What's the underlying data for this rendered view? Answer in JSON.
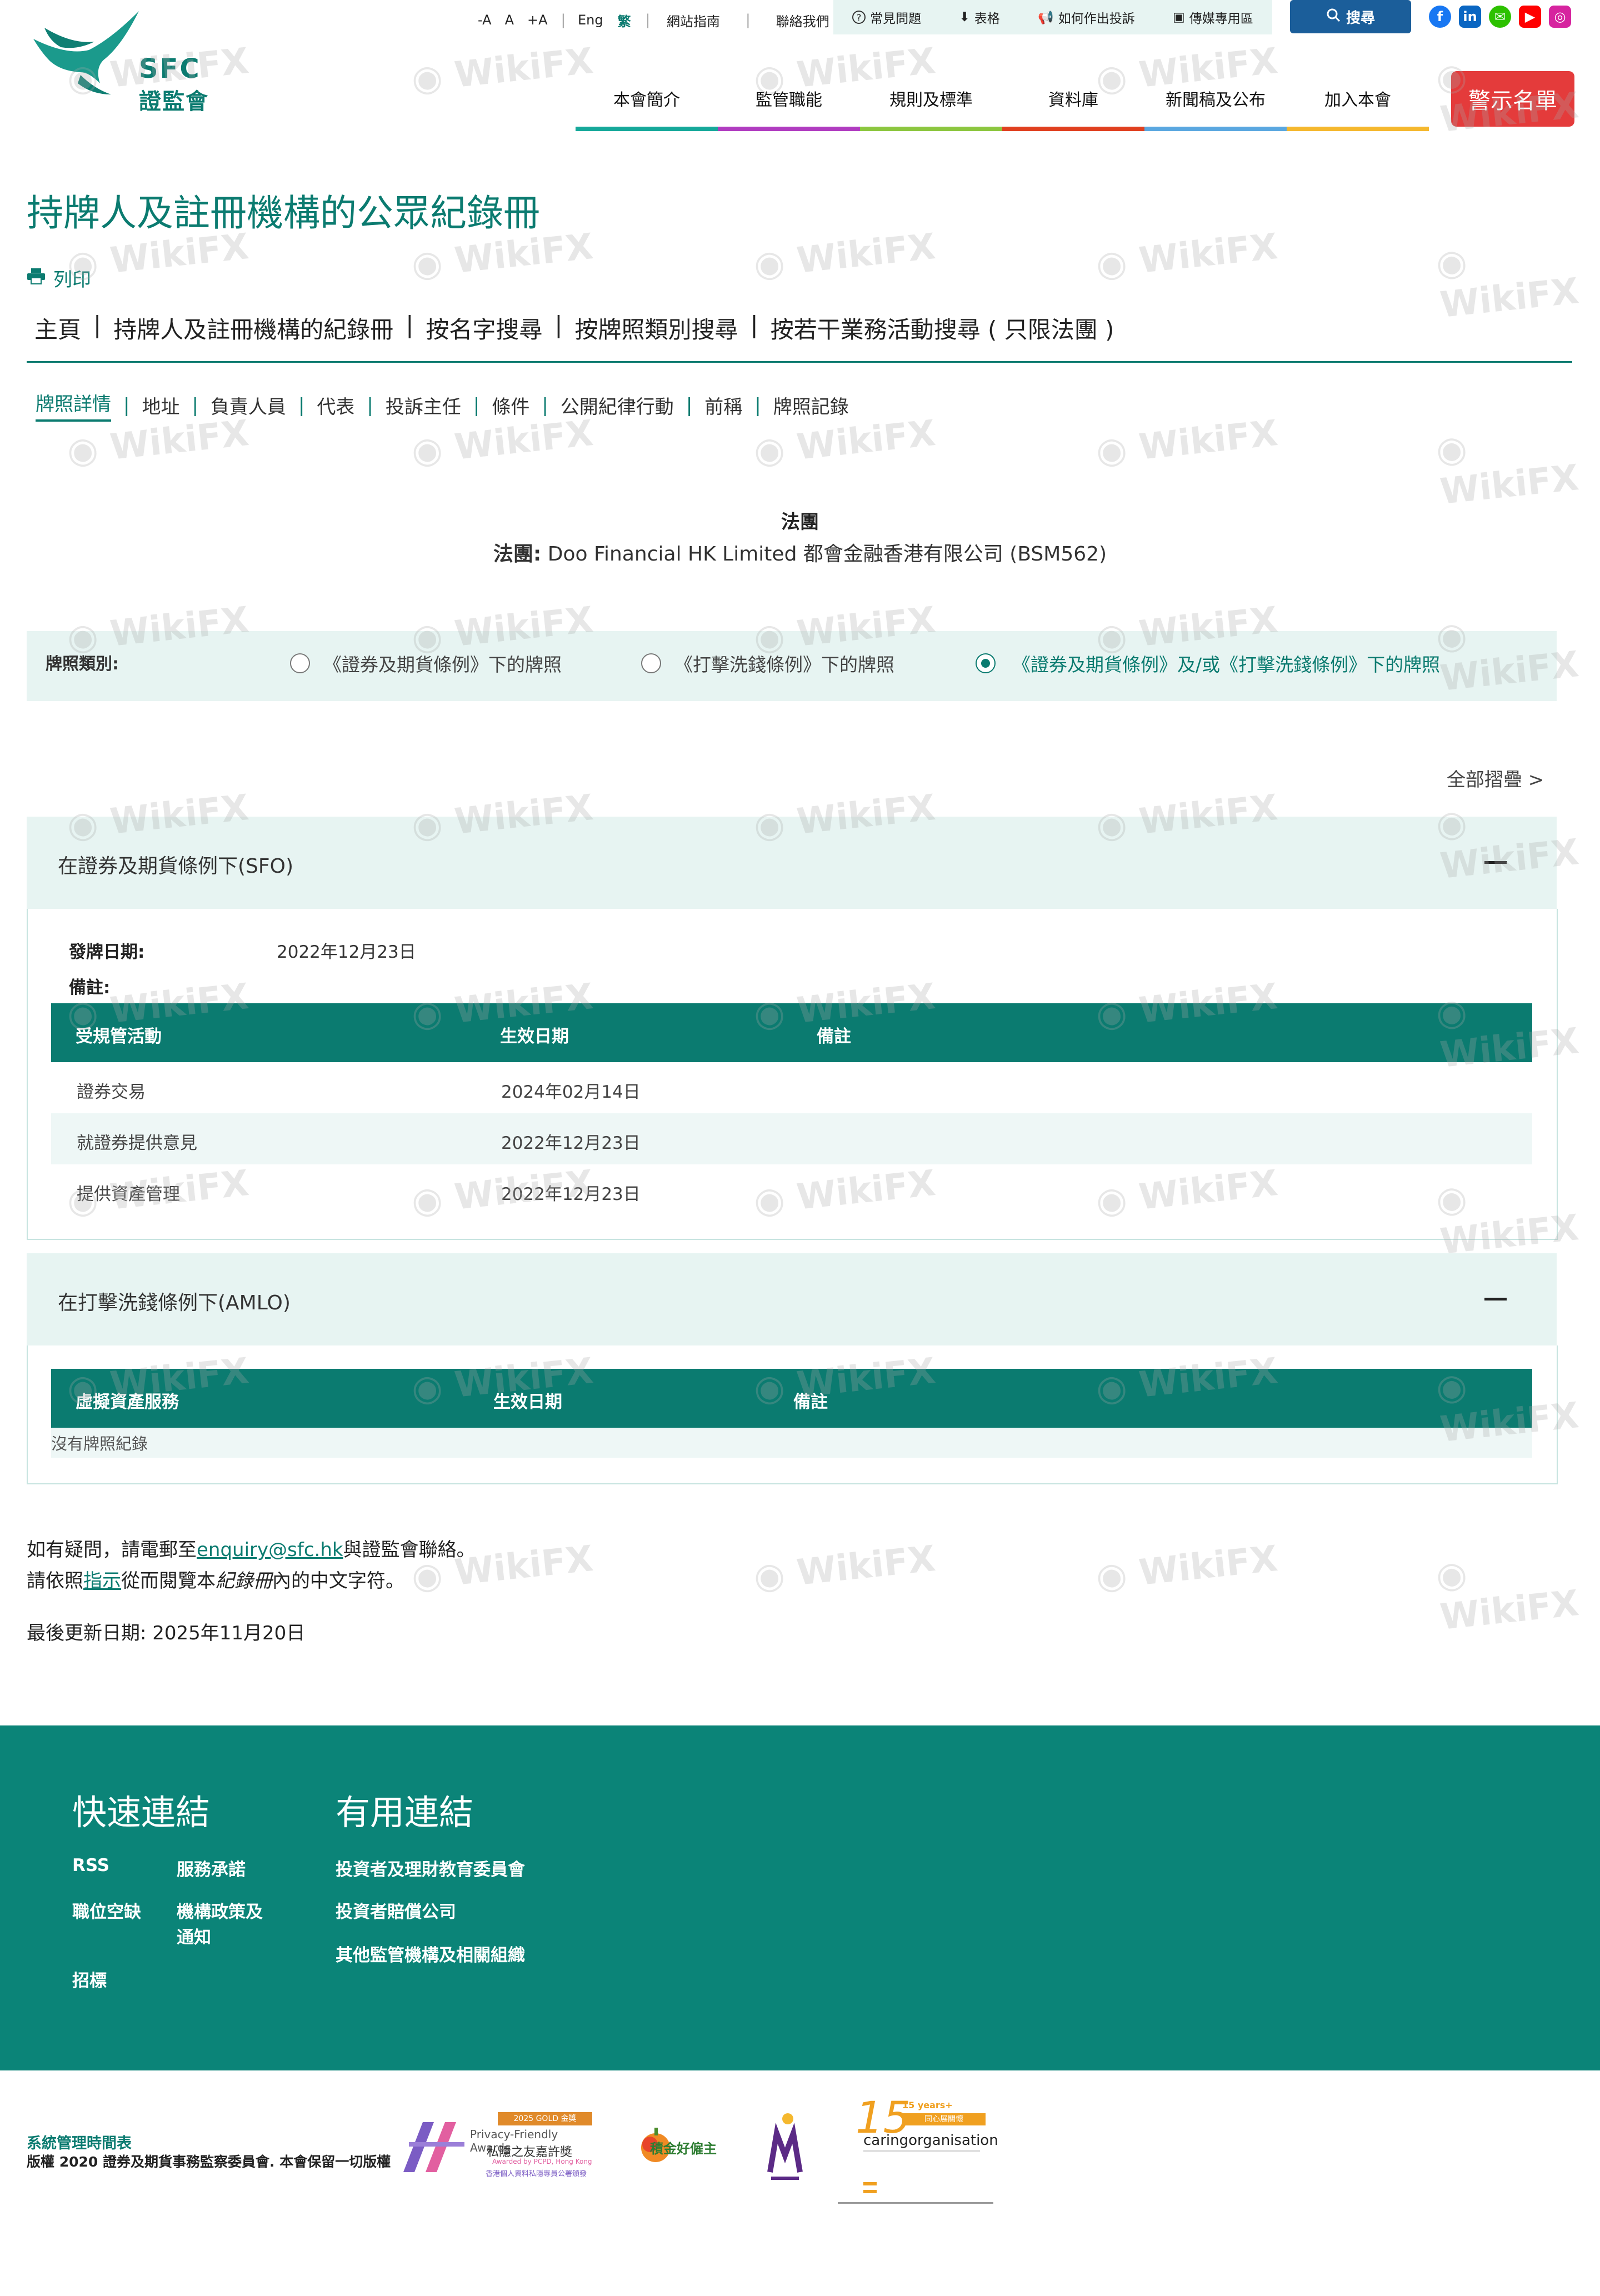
{
  "logo": {
    "en": "SFC",
    "zh": "證監會"
  },
  "util": {
    "font_small": "-A",
    "font_normal": "A",
    "font_large": "+A",
    "lang_en": "Eng",
    "lang_zh": "繁",
    "sitemap": "網站指南",
    "contact": "聯絡我們",
    "faq": "常見問題",
    "forms": "表格",
    "complaint": "如何作出投訴",
    "media": "傳媒專用區",
    "search": "搜尋"
  },
  "social": [
    {
      "name": "facebook",
      "glyph": "f",
      "color": "#1877f2"
    },
    {
      "name": "linkedin",
      "glyph": "in",
      "color": "#0a66c2"
    },
    {
      "name": "wechat",
      "glyph": "✉",
      "color": "#2dc100"
    },
    {
      "name": "youtube",
      "glyph": "▶",
      "color": "#ff0000"
    },
    {
      "name": "instagram",
      "glyph": "◎",
      "color": "#d6249f"
    }
  ],
  "nav": {
    "items": [
      {
        "label": "本會簡介",
        "color": "#16a89a"
      },
      {
        "label": "監管職能",
        "color": "#b03cc0"
      },
      {
        "label": "規則及標準",
        "color": "#8cc63f"
      },
      {
        "label": "資料庫",
        "color": "#e0401f"
      },
      {
        "label": "新聞稿及公布",
        "color": "#5aa7e0"
      },
      {
        "label": "加入本會",
        "color": "#f5b82e"
      }
    ],
    "warning": "警示名單"
  },
  "page": {
    "title": "持牌人及註冊機構的公眾紀錄冊",
    "print": "列印",
    "breadcrumb": [
      "主頁",
      "持牌人及註冊機構的紀錄冊",
      "按名字搜尋",
      "按牌照類別搜尋",
      "按若干業務活動搜尋 ( 只限法團 )"
    ],
    "tabs": [
      "牌照詳情",
      "地址",
      "負責人員",
      "代表",
      "投訴主任",
      "條件",
      "公開紀律行動",
      "前稱",
      "牌照記錄"
    ]
  },
  "entity": {
    "type": "法團",
    "name_label": "法團:",
    "name": "Doo Financial HK Limited 都會金融香港有限公司 (BSM562)"
  },
  "license_type": {
    "label": "牌照類別:",
    "options": [
      {
        "label": "《證券及期貨條例》下的牌照",
        "selected": false
      },
      {
        "label": "《打擊洗錢條例》下的牌照",
        "selected": false
      },
      {
        "label": "《證券及期貨條例》及/或《打擊洗錢條例》下的牌照",
        "selected": true
      }
    ]
  },
  "collapse_all": "全部摺疊 >",
  "sfo": {
    "title": "在證券及期貨條例下(SFO)",
    "issue_label": "發牌日期:",
    "issue_date": "2022年12月23日",
    "remarks_label": "備註:",
    "columns": [
      "受規管活動",
      "生效日期",
      "備註"
    ],
    "rows": [
      {
        "activity": "證券交易",
        "date": "2024年02月14日",
        "remark": ""
      },
      {
        "activity": "就證券提供意見",
        "date": "2022年12月23日",
        "remark": ""
      },
      {
        "activity": "提供資產管理",
        "date": "2022年12月23日",
        "remark": ""
      }
    ]
  },
  "amlo": {
    "title": "在打擊洗錢條例下(AMLO)",
    "columns": [
      "虛擬資產服務",
      "生效日期",
      "備註"
    ],
    "empty": "沒有牌照紀錄"
  },
  "notes": {
    "enquiry_prefix": "如有疑問，請電郵至",
    "enquiry_email": "enquiry@sfc.hk",
    "enquiry_suffix": "與證監會聯絡。",
    "guide_prefix": "請依照",
    "guide_link": "指示",
    "guide_mid": "從而閱覽本",
    "guide_italic": "紀錄冊",
    "guide_suffix": "內的中文字符。",
    "updated": "最後更新日期: 2025年11月20日"
  },
  "footer": {
    "quick_title": "快速連結",
    "quick": [
      "RSS",
      "服務承諾",
      "職位空缺",
      "機構政策及",
      "通知",
      "招標"
    ],
    "useful_title": "有用連結",
    "useful": [
      "投資者及理財教育委員會",
      "投資者賠償公司",
      "其他監管機構及相關組織"
    ],
    "sysmgmt": "系統管理時間表",
    "copyright": "版權 2020 證券及期貨事務監察委員會. 本會保留一切版權",
    "awards": [
      "2025 GOLD 金獎",
      "Privacy-Friendly Awards",
      "私隱之友嘉許獎",
      "Awarded by PCPD, Hong Kong",
      "香港個人資料私隱專員公署頒發",
      "PCPD",
      "積金好僱主",
      "15 years+",
      "同心展關懷",
      "caringorganisation"
    ]
  },
  "watermark": "WikiFX"
}
